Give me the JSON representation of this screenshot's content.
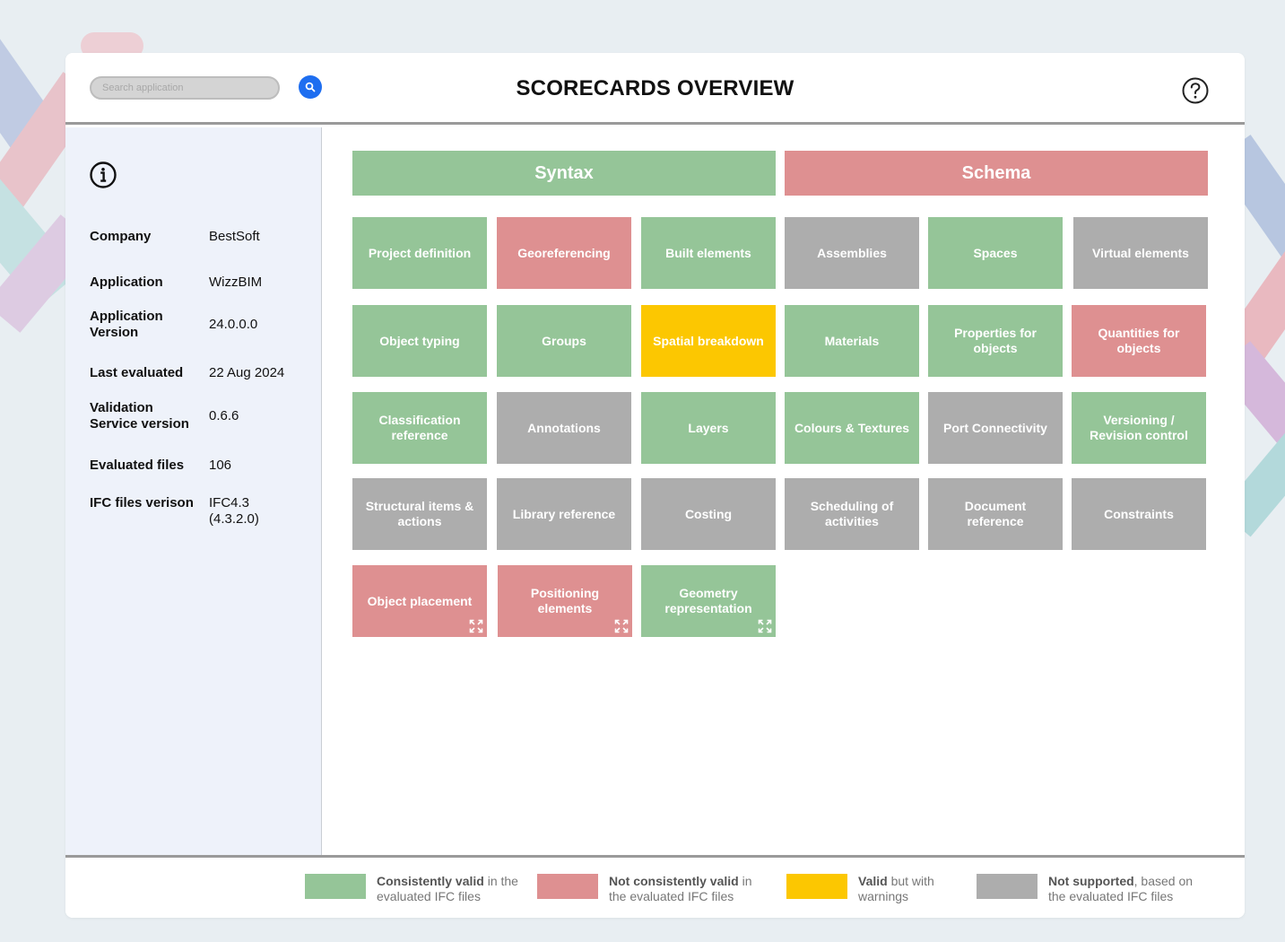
{
  "header": {
    "search_placeholder": "Search application",
    "title": "SCORECARDS OVERVIEW"
  },
  "icons": {
    "search": "search-icon",
    "help": "help-icon",
    "info": "info-icon",
    "expand": "expand-icon"
  },
  "colors": {
    "consistently_valid": "#95c598",
    "not_consistently_valid": "#de9091",
    "valid_with_warnings": "#fcc701",
    "not_supported": "#adadad",
    "search_button": "#1e6ef0"
  },
  "sidebar": {
    "rows": [
      {
        "label": "Company",
        "value": "BestSoft"
      },
      {
        "label": "Application",
        "value": "WizzBIM"
      },
      {
        "label": "Application Version",
        "value": "24.0.0.0"
      },
      {
        "label": "Last evaluated",
        "value": "22 Aug 2024"
      },
      {
        "label": "Validation Service version",
        "value": "0.6.6"
      },
      {
        "label": "Evaluated files",
        "value": "106"
      },
      {
        "label": "IFC files verison",
        "value": "IFC4.3 (4.3.2.0)"
      }
    ]
  },
  "categories": [
    {
      "label": "Syntax",
      "status": "consistently_valid"
    },
    {
      "label": "Schema",
      "status": "not_consistently_valid"
    }
  ],
  "tiles": [
    {
      "label": "Project definition",
      "status": "consistently_valid"
    },
    {
      "label": "Georeferencing",
      "status": "not_consistently_valid"
    },
    {
      "label": "Built elements",
      "status": "consistently_valid"
    },
    {
      "label": "Assemblies",
      "status": "not_supported"
    },
    {
      "label": "Spaces",
      "status": "consistently_valid"
    },
    {
      "label": "Virtual elements",
      "status": "not_supported"
    },
    {
      "label": "Object typing",
      "status": "consistently_valid"
    },
    {
      "label": "Groups",
      "status": "consistently_valid"
    },
    {
      "label": "Spatial breakdown",
      "status": "valid_with_warnings"
    },
    {
      "label": "Materials",
      "status": "consistently_valid"
    },
    {
      "label": "Properties for objects",
      "status": "consistently_valid"
    },
    {
      "label": "Quantities for objects",
      "status": "not_consistently_valid"
    },
    {
      "label": "Classification reference",
      "status": "consistently_valid"
    },
    {
      "label": "Annotations",
      "status": "not_supported"
    },
    {
      "label": "Layers",
      "status": "consistently_valid"
    },
    {
      "label": "Colours & Textures",
      "status": "consistently_valid"
    },
    {
      "label": "Port Connectivity",
      "status": "not_supported"
    },
    {
      "label": "Versioning / Revision control",
      "status": "consistently_valid"
    },
    {
      "label": "Structural items & actions",
      "status": "not_supported"
    },
    {
      "label": "Library reference",
      "status": "not_supported"
    },
    {
      "label": "Costing",
      "status": "not_supported"
    },
    {
      "label": "Scheduling of activities",
      "status": "not_supported"
    },
    {
      "label": "Document reference",
      "status": "not_supported"
    },
    {
      "label": "Constraints",
      "status": "not_supported"
    },
    {
      "label": "Object placement",
      "status": "not_consistently_valid",
      "expandable": true
    },
    {
      "label": "Positioning elements",
      "status": "not_consistently_valid",
      "expandable": true
    },
    {
      "label": "Geometry representation",
      "status": "consistently_valid",
      "expandable": true
    }
  ],
  "legend": [
    {
      "bold": "Consistently valid",
      "rest": " in the evaluated IFC files",
      "status": "consistently_valid"
    },
    {
      "bold": "Not consistently valid",
      "rest": " in the evaluated IFC files",
      "status": "not_consistently_valid"
    },
    {
      "bold": "Valid",
      "rest": " but with warnings",
      "status": "valid_with_warnings"
    },
    {
      "bold": "Not supported",
      "rest": ", based on the evaluated IFC files",
      "status": "not_supported"
    }
  ]
}
